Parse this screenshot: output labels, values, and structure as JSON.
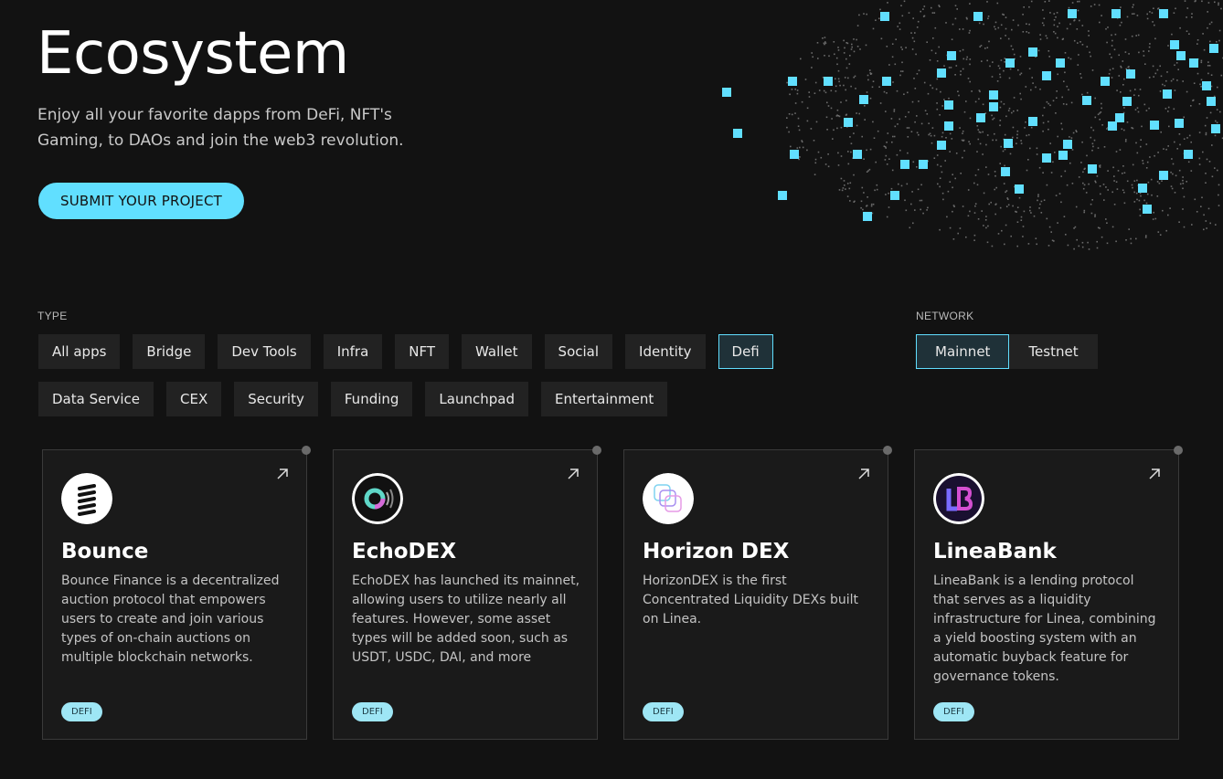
{
  "hero": {
    "title": "Ecosystem",
    "subtitle": "Enjoy all your favorite dapps from DeFi, NFT's Gaming, to DAOs and join the web3 revolution.",
    "submit_label": "SUBMIT YOUR PROJECT"
  },
  "colors": {
    "accent": "#61dfff",
    "background": "#121212",
    "card_bg": "#1a1a1a",
    "chip_bg": "#222222"
  },
  "filters": {
    "type_label": "TYPE",
    "type_chips": [
      {
        "label": "All apps",
        "active": false
      },
      {
        "label": "Bridge",
        "active": false
      },
      {
        "label": "Dev Tools",
        "active": false
      },
      {
        "label": "Infra",
        "active": false
      },
      {
        "label": "NFT",
        "active": false
      },
      {
        "label": "Wallet",
        "active": false
      },
      {
        "label": "Social",
        "active": false
      },
      {
        "label": "Identity",
        "active": false
      },
      {
        "label": "Defi",
        "active": true
      },
      {
        "label": "Data Service",
        "active": false
      },
      {
        "label": "CEX",
        "active": false
      },
      {
        "label": "Security",
        "active": false
      },
      {
        "label": "Funding",
        "active": false
      },
      {
        "label": "Launchpad",
        "active": false
      },
      {
        "label": "Entertainment",
        "active": false
      }
    ],
    "network_label": "NETWORK",
    "network_chips": [
      {
        "label": "Mainnet",
        "active": true
      },
      {
        "label": "Testnet",
        "active": false
      }
    ]
  },
  "cards": [
    {
      "name": "Bounce",
      "logo": "bounce-logo-icon",
      "desc": "Bounce Finance is a decentralized auction protocol that empowers users to create and join various types of on-chain auctions on multiple blockchain networks.",
      "tag": "DEFI"
    },
    {
      "name": "EchoDEX",
      "logo": "echodex-logo-icon",
      "desc": "EchoDEX has launched its mainnet, allowing users to utilize nearly all features. However, some asset types will be added soon, such as USDT, USDC, DAI, and more",
      "tag": "DEFI"
    },
    {
      "name": "Horizon DEX",
      "logo": "horizon-dex-logo-icon",
      "desc": "HorizonDEX is the first Concentrated Liquidity DEXs built on Linea.",
      "tag": "DEFI"
    },
    {
      "name": "LineaBank",
      "logo": "lineabank-logo-icon",
      "desc": "LineaBank is a lending protocol that serves as a liquidity infrastructure for Linea, combining a yield boosting system with an automatic buyback feature for governance tokens.",
      "tag": "DEFI"
    }
  ]
}
